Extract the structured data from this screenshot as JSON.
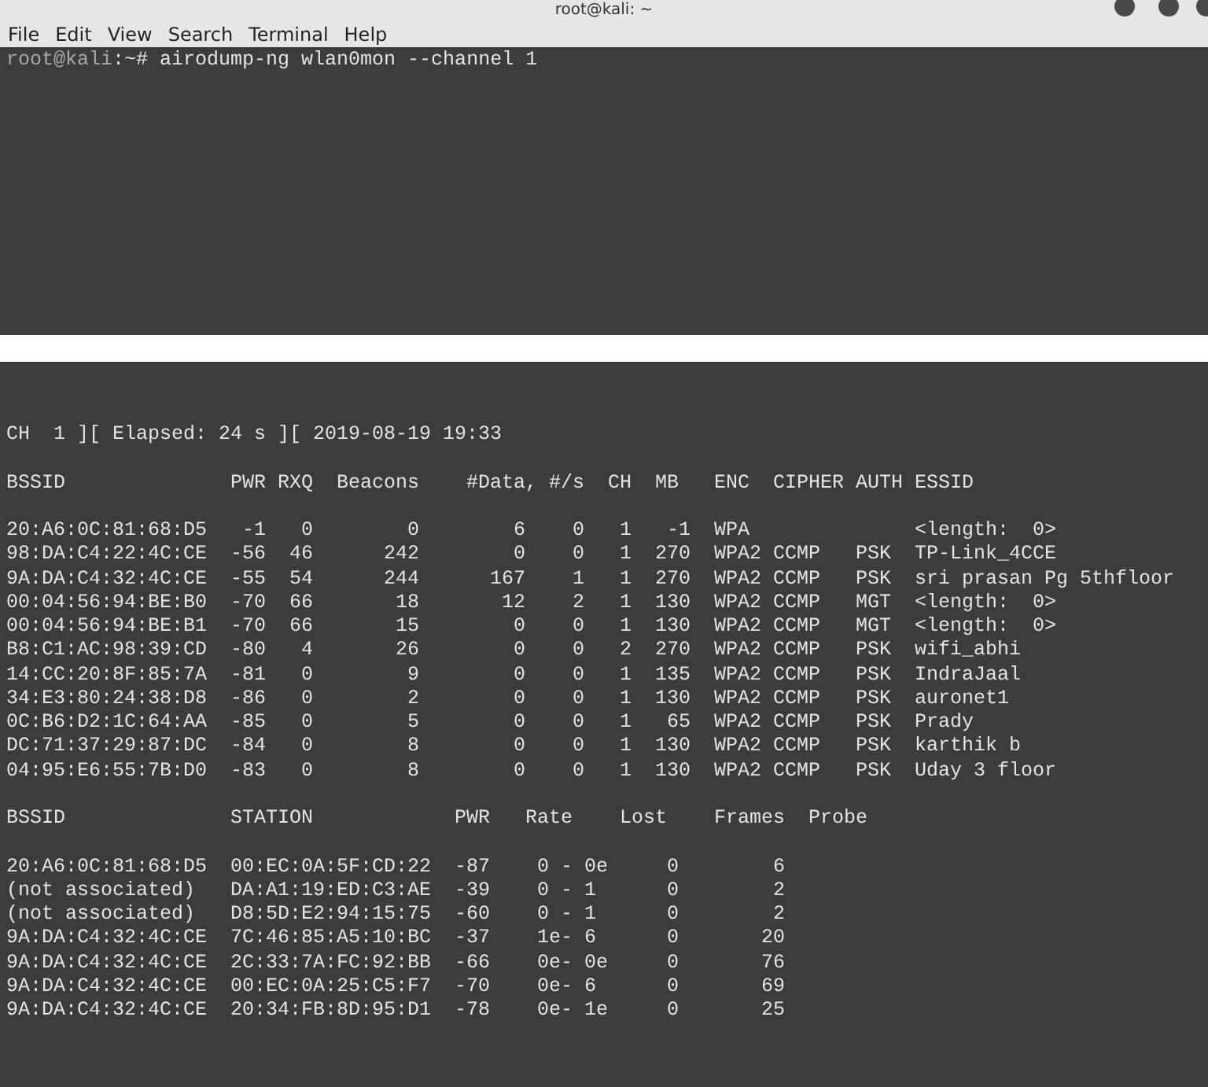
{
  "window": {
    "title": "root@kali: ~"
  },
  "menu": [
    "File",
    "Edit",
    "View",
    "Search",
    "Terminal",
    "Help"
  ],
  "prompt": {
    "user_host": "root@kali",
    "path": ":~#",
    "command": "airodump-ng wlan0mon --channel 1"
  },
  "status_line": "CH  1 ][ Elapsed: 24 s ][ 2019-08-19 19:33",
  "access_points": {
    "columns": [
      "BSSID",
      "PWR",
      "RXQ",
      "Beacons",
      "#Data,",
      "#/s",
      "CH",
      "MB",
      "ENC",
      "CIPHER",
      "AUTH",
      "ESSID"
    ],
    "rows": [
      {
        "bssid": "20:A6:0C:81:68:D5",
        "pwr": "-1",
        "rxq": "0",
        "beacons": "0",
        "data": "6",
        "per_s": "0",
        "ch": "1",
        "mb": "-1",
        "enc": "WPA",
        "essid": "<length:  0>"
      },
      {
        "bssid": "98:DA:C4:22:4C:CE",
        "pwr": "-56",
        "rxq": "46",
        "beacons": "242",
        "data": "0",
        "per_s": "0",
        "ch": "1",
        "mb": "270",
        "enc": "WPA2",
        "cipher": "CCMP",
        "auth": "PSK",
        "essid": "TP-Link_4CCE"
      },
      {
        "bssid": "9A:DA:C4:32:4C:CE",
        "pwr": "-55",
        "rxq": "54",
        "beacons": "244",
        "data": "167",
        "per_s": "1",
        "ch": "1",
        "mb": "270",
        "enc": "WPA2",
        "cipher": "CCMP",
        "auth": "PSK",
        "essid": "sri prasan Pg 5thfloor"
      },
      {
        "bssid": "00:04:56:94:BE:B0",
        "pwr": "-70",
        "rxq": "66",
        "beacons": "18",
        "data": "12",
        "per_s": "2",
        "ch": "1",
        "mb": "130",
        "enc": "WPA2",
        "cipher": "CCMP",
        "auth": "MGT",
        "essid": "<length:  0>"
      },
      {
        "bssid": "00:04:56:94:BE:B1",
        "pwr": "-70",
        "rxq": "66",
        "beacons": "15",
        "data": "0",
        "per_s": "0",
        "ch": "1",
        "mb": "130",
        "enc": "WPA2",
        "cipher": "CCMP",
        "auth": "MGT",
        "essid": "<length:  0>"
      },
      {
        "bssid": "B8:C1:AC:98:39:CD",
        "pwr": "-80",
        "rxq": "4",
        "beacons": "26",
        "data": "0",
        "per_s": "0",
        "ch": "2",
        "mb": "270",
        "enc": "WPA2",
        "cipher": "CCMP",
        "auth": "PSK",
        "essid": "wifi_abhi"
      },
      {
        "bssid": "14:CC:20:8F:85:7A",
        "pwr": "-81",
        "rxq": "0",
        "beacons": "9",
        "data": "0",
        "per_s": "0",
        "ch": "1",
        "mb": "135",
        "enc": "WPA2",
        "cipher": "CCMP",
        "auth": "PSK",
        "essid": "IndraJaal"
      },
      {
        "bssid": "34:E3:80:24:38:D8",
        "pwr": "-86",
        "rxq": "0",
        "beacons": "2",
        "data": "0",
        "per_s": "0",
        "ch": "1",
        "mb": "130",
        "enc": "WPA2",
        "cipher": "CCMP",
        "auth": "PSK",
        "essid": "auronet1"
      },
      {
        "bssid": "0C:B6:D2:1C:64:AA",
        "pwr": "-85",
        "rxq": "0",
        "beacons": "5",
        "data": "0",
        "per_s": "0",
        "ch": "1",
        "mb": "65",
        "enc": "WPA2",
        "cipher": "CCMP",
        "auth": "PSK",
        "essid": "Prady"
      },
      {
        "bssid": "DC:71:37:29:87:DC",
        "pwr": "-84",
        "rxq": "0",
        "beacons": "8",
        "data": "0",
        "per_s": "0",
        "ch": "1",
        "mb": "130",
        "enc": "WPA2",
        "cipher": "CCMP",
        "auth": "PSK",
        "essid": "karthik b"
      },
      {
        "bssid": "04:95:E6:55:7B:D0",
        "pwr": "-83",
        "rxq": "0",
        "beacons": "8",
        "data": "0",
        "per_s": "0",
        "ch": "1",
        "mb": "130",
        "enc": "WPA2",
        "cipher": "CCMP",
        "auth": "PSK",
        "essid": "Uday 3 floor"
      }
    ]
  },
  "stations": {
    "columns": [
      "BSSID",
      "STATION",
      "PWR",
      "Rate",
      "Lost",
      "Frames",
      "Probe"
    ],
    "rows": [
      {
        "bssid": "20:A6:0C:81:68:D5",
        "station": "00:EC:0A:5F:CD:22",
        "pwr": "-87",
        "rate": "0 - 0e",
        "lost": "0",
        "frames": "6"
      },
      {
        "bssid": "(not associated)",
        "station": "DA:A1:19:ED:C3:AE",
        "pwr": "-39",
        "rate": "0 - 1",
        "lost": "0",
        "frames": "2"
      },
      {
        "bssid": "(not associated)",
        "station": "D8:5D:E2:94:15:75",
        "pwr": "-60",
        "rate": "0 - 1",
        "lost": "0",
        "frames": "2"
      },
      {
        "bssid": "9A:DA:C4:32:4C:CE",
        "station": "7C:46:85:A5:10:BC",
        "pwr": "-37",
        "rate": "1e- 6",
        "lost": "0",
        "frames": "20"
      },
      {
        "bssid": "9A:DA:C4:32:4C:CE",
        "station": "2C:33:7A:FC:92:BB",
        "pwr": "-66",
        "rate": "0e- 0e",
        "lost": "0",
        "frames": "76"
      },
      {
        "bssid": "9A:DA:C4:32:4C:CE",
        "station": "00:EC:0A:25:C5:F7",
        "pwr": "-70",
        "rate": "0e- 6",
        "lost": "0",
        "frames": "69"
      },
      {
        "bssid": "9A:DA:C4:32:4C:CE",
        "station": "20:34:FB:8D:95:D1",
        "pwr": "-78",
        "rate": "0e- 1e",
        "lost": "0",
        "frames": "25"
      }
    ]
  }
}
